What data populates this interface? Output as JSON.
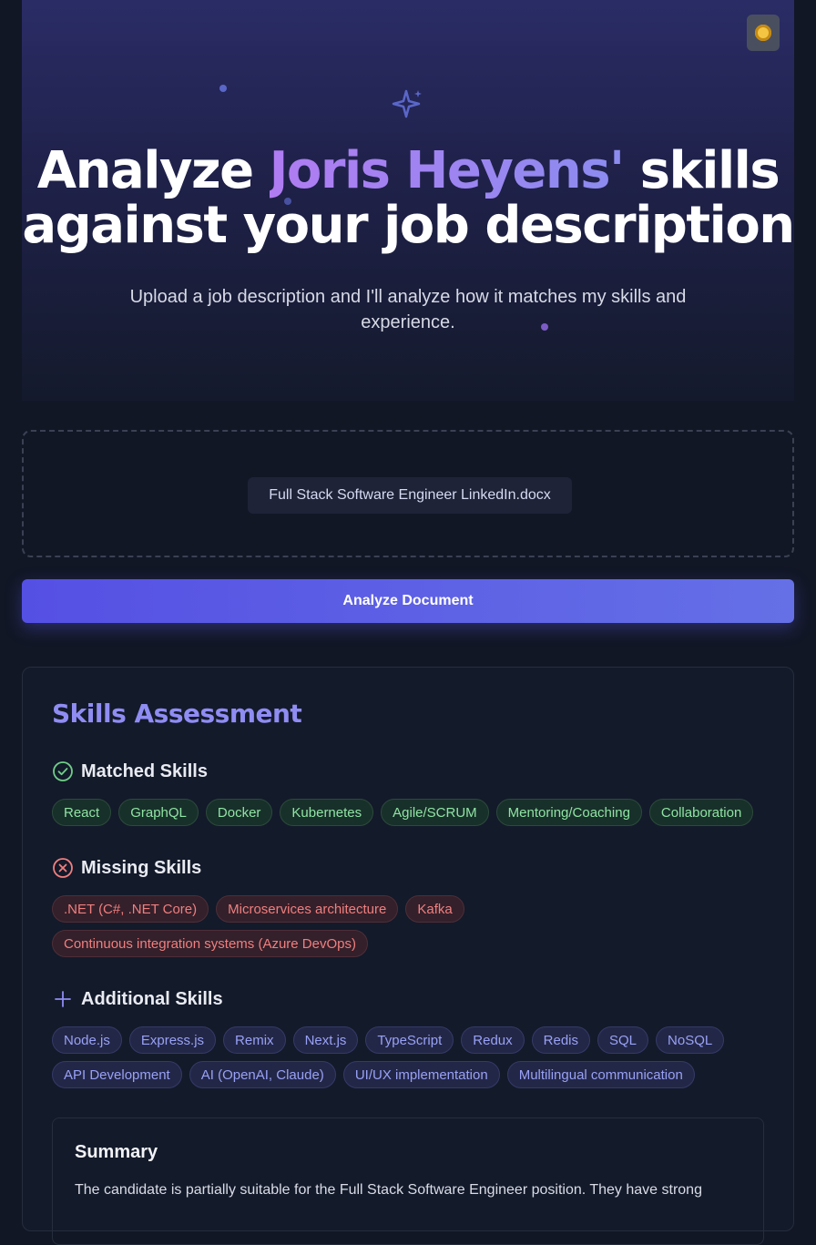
{
  "hero": {
    "title_before": "Analyze ",
    "title_highlight": "Joris Heyens'",
    "title_after": " skills against your job description",
    "subtitle": "Upload a job description and I'll analyze how it matches my skills and experience."
  },
  "theme_toggle": {
    "icon": "sun-icon"
  },
  "upload": {
    "file_name": "Full Stack Software Engineer LinkedIn.docx"
  },
  "analyze_button": {
    "label": "Analyze Document"
  },
  "assessment": {
    "title": "Skills Assessment",
    "matched": {
      "heading": "Matched Skills",
      "icon": "check-circle-icon",
      "color": "#6fcf87",
      "skills": [
        "React",
        "GraphQL",
        "Docker",
        "Kubernetes",
        "Agile/SCRUM",
        "Mentoring/Coaching",
        "Collaboration"
      ]
    },
    "missing": {
      "heading": "Missing Skills",
      "icon": "x-circle-icon",
      "color": "#f07f7f",
      "skills": [
        ".NET (C#, .NET Core)",
        "Microservices architecture",
        "Kafka",
        "Continuous integration systems (Azure DevOps)"
      ]
    },
    "additional": {
      "heading": "Additional Skills",
      "icon": "plus-icon",
      "color": "#8f8cf3",
      "skills": [
        "Node.js",
        "Express.js",
        "Remix",
        "Next.js",
        "TypeScript",
        "Redux",
        "Redis",
        "SQL",
        "NoSQL",
        "API Development",
        "AI (OpenAI, Claude)",
        "UI/UX implementation",
        "Multilingual communication"
      ]
    },
    "summary": {
      "title": "Summary",
      "text": "The candidate is partially suitable for the Full Stack Software Engineer position. They have strong"
    }
  },
  "colors": {
    "accent": "#8f8cf3",
    "button": "#5a5ce5",
    "background": "#121726"
  }
}
